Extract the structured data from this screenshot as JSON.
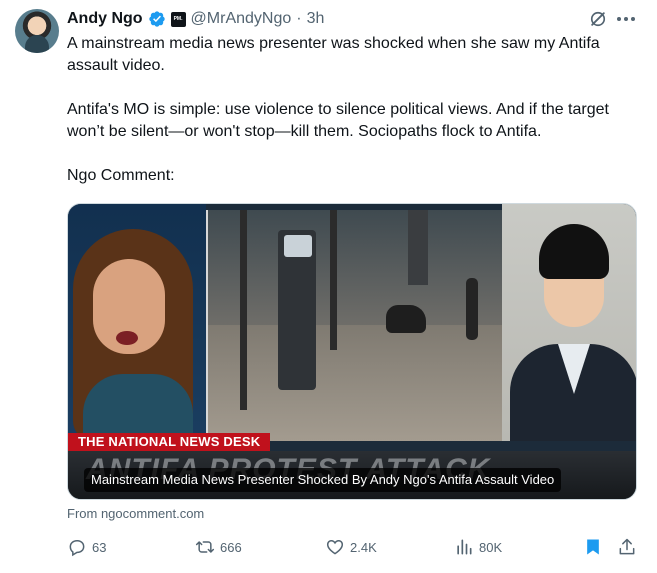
{
  "author": {
    "name": "Andy Ngo",
    "handle": "@MrAndyNgo",
    "time": "3h",
    "separator": "·",
    "affiliation_badge": "PM."
  },
  "tweet": {
    "paragraphs": [
      "A mainstream media news presenter was shocked when she saw my Antifa assault video.",
      "Antifa's MO is simple: use violence to silence political views. And if the target won’t be silent—or won't stop—kill them. Sociopaths flock to Antifa.",
      "Ngo Comment:"
    ]
  },
  "card": {
    "banner": "THE NATIONAL NEWS DESK",
    "lower_third": "ANTIFA PROTEST ATTACK",
    "title": "Mainstream Media News Presenter Shocked By Andy Ngo's Antifa Assault Video",
    "source": "From ngocomment.com"
  },
  "actions": {
    "replies": "63",
    "reposts": "666",
    "likes": "2.4K",
    "views": "80K"
  },
  "icons": {
    "verified": "verified-badge-icon",
    "grok": "grok-icon",
    "more": "more-icon",
    "reply": "reply-icon",
    "repost": "repost-icon",
    "like": "like-icon",
    "views": "views-icon",
    "bookmark": "bookmark-icon",
    "share": "share-icon"
  },
  "colors": {
    "accent": "#1d9bf0",
    "text": "#0f1419",
    "secondary": "#536471",
    "banner_red": "#c0111c"
  }
}
